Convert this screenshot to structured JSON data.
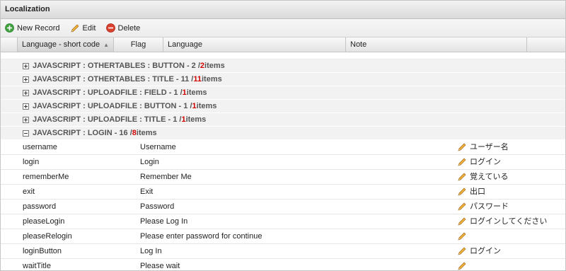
{
  "window": {
    "title": "Localization"
  },
  "toolbar": {
    "new_label": "New Record",
    "edit_label": "Edit",
    "delete_label": "Delete"
  },
  "columns": {
    "short_code": "Language - short code",
    "flag": "Flag",
    "language": "Language",
    "note": "Note"
  },
  "groups": [
    {
      "name": "JAVASCRIPT : OTHERTABLES : BUTTON - 2 / ",
      "count": "2",
      "suffix": " items",
      "expanded": false
    },
    {
      "name": "JAVASCRIPT : OTHERTABLES : TITLE - 11 / ",
      "count": "11",
      "suffix": " items",
      "expanded": false
    },
    {
      "name": "JAVASCRIPT : UPLOADFILE : FIELD - 1 / ",
      "count": "1",
      "suffix": " items",
      "expanded": false
    },
    {
      "name": "JAVASCRIPT : UPLOADFILE : BUTTON - 1 / ",
      "count": "1",
      "suffix": " items",
      "expanded": false
    },
    {
      "name": "JAVASCRIPT : UPLOADFILE : TITLE - 1 / ",
      "count": "1",
      "suffix": " items",
      "expanded": false
    },
    {
      "name": "JAVASCRIPT : LOGIN - 16 / ",
      "count": "8",
      "suffix": " items",
      "expanded": true
    }
  ],
  "rows": [
    {
      "key": "username",
      "value": "Username",
      "translation": "ユーザー名"
    },
    {
      "key": "login",
      "value": "Login",
      "translation": "ログイン"
    },
    {
      "key": "rememberMe",
      "value": "Remember Me",
      "translation": "覚えている"
    },
    {
      "key": "exit",
      "value": "Exit",
      "translation": "出口"
    },
    {
      "key": "password",
      "value": "Password",
      "translation": "パスワード"
    },
    {
      "key": "pleaseLogin",
      "value": "Please Log In",
      "translation": "ログインしてください"
    },
    {
      "key": "pleaseRelogin",
      "value": "Please enter password for continue",
      "translation": ""
    },
    {
      "key": "loginButton",
      "value": "Log In",
      "translation": "ログイン"
    },
    {
      "key": "waitTitle",
      "value": "Please wait",
      "translation": ""
    }
  ],
  "icons": {
    "new": "add-circle-icon",
    "edit": "pencil-icon",
    "delete": "delete-circle-icon",
    "expand": "plus-box-icon",
    "collapse": "minus-box-icon",
    "sort": "sort-asc-icon"
  },
  "colors": {
    "count_highlight": "#d00000",
    "new_icon": "#3fa33f",
    "delete_icon": "#d9412e",
    "pencil": "#e8a52c"
  }
}
